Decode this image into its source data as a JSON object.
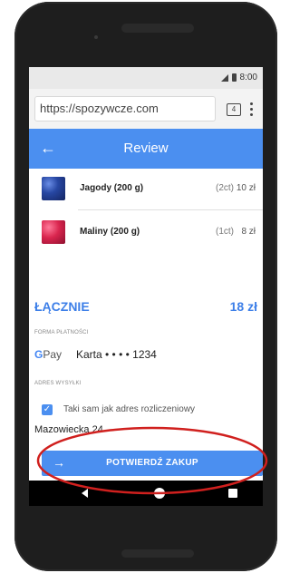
{
  "status_bar": {
    "time": "8:00"
  },
  "browser": {
    "url": "https://spozywcze.com",
    "tab_count": "4"
  },
  "app_bar": {
    "title": "Review"
  },
  "items": [
    {
      "name": "Jagody (200 g)",
      "qty": "(2ct)",
      "price": "10 zł"
    },
    {
      "name": "Maliny (200 g)",
      "qty": "(1ct)",
      "price": "8 zł"
    }
  ],
  "total": {
    "label": "ŁĄCZNIE",
    "value": "18 zł"
  },
  "payment": {
    "section_label": "FORMA PŁATNOŚCI",
    "gpay_g": "G",
    "gpay_rest": "Pay",
    "card": "Karta • • • • 1234"
  },
  "shipping": {
    "section_label": "ADRES WYSYŁKI",
    "same_address_label": "Taki sam jak adres rozliczeniowy",
    "same_address_checked": true,
    "address": "Mazowiecka 24"
  },
  "confirm_button": {
    "label": "POTWIERDŹ ZAKUP"
  },
  "colors": {
    "accent": "#4b8ff0",
    "highlight": "#d0201e",
    "phone_body": "#1e1e1e"
  }
}
